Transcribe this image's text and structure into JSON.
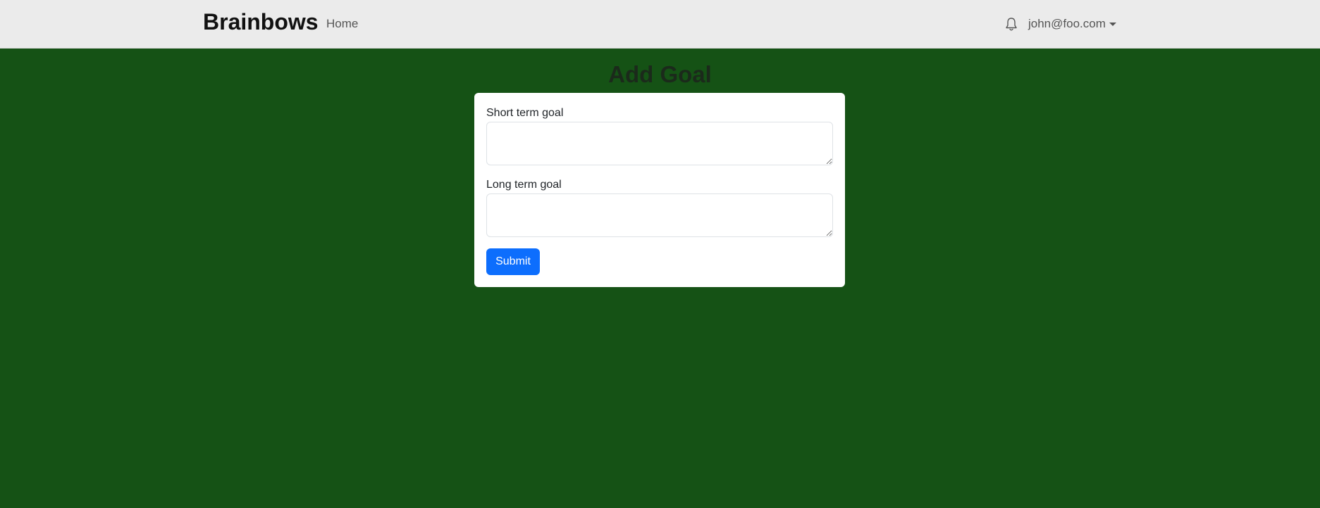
{
  "navbar": {
    "brand": "Brainbows",
    "links": [
      {
        "label": "Home"
      }
    ],
    "bell_icon": "bell-icon",
    "user_email": "john@foo.com"
  },
  "page": {
    "title": "Add Goal"
  },
  "form": {
    "short_term_label": "Short term goal",
    "short_term_value": "",
    "long_term_label": "Long term goal",
    "long_term_value": "",
    "submit_label": "Submit"
  },
  "colors": {
    "page_background": "#155215",
    "navbar_background": "#ebebeb",
    "primary_button": "#0d6efd"
  }
}
